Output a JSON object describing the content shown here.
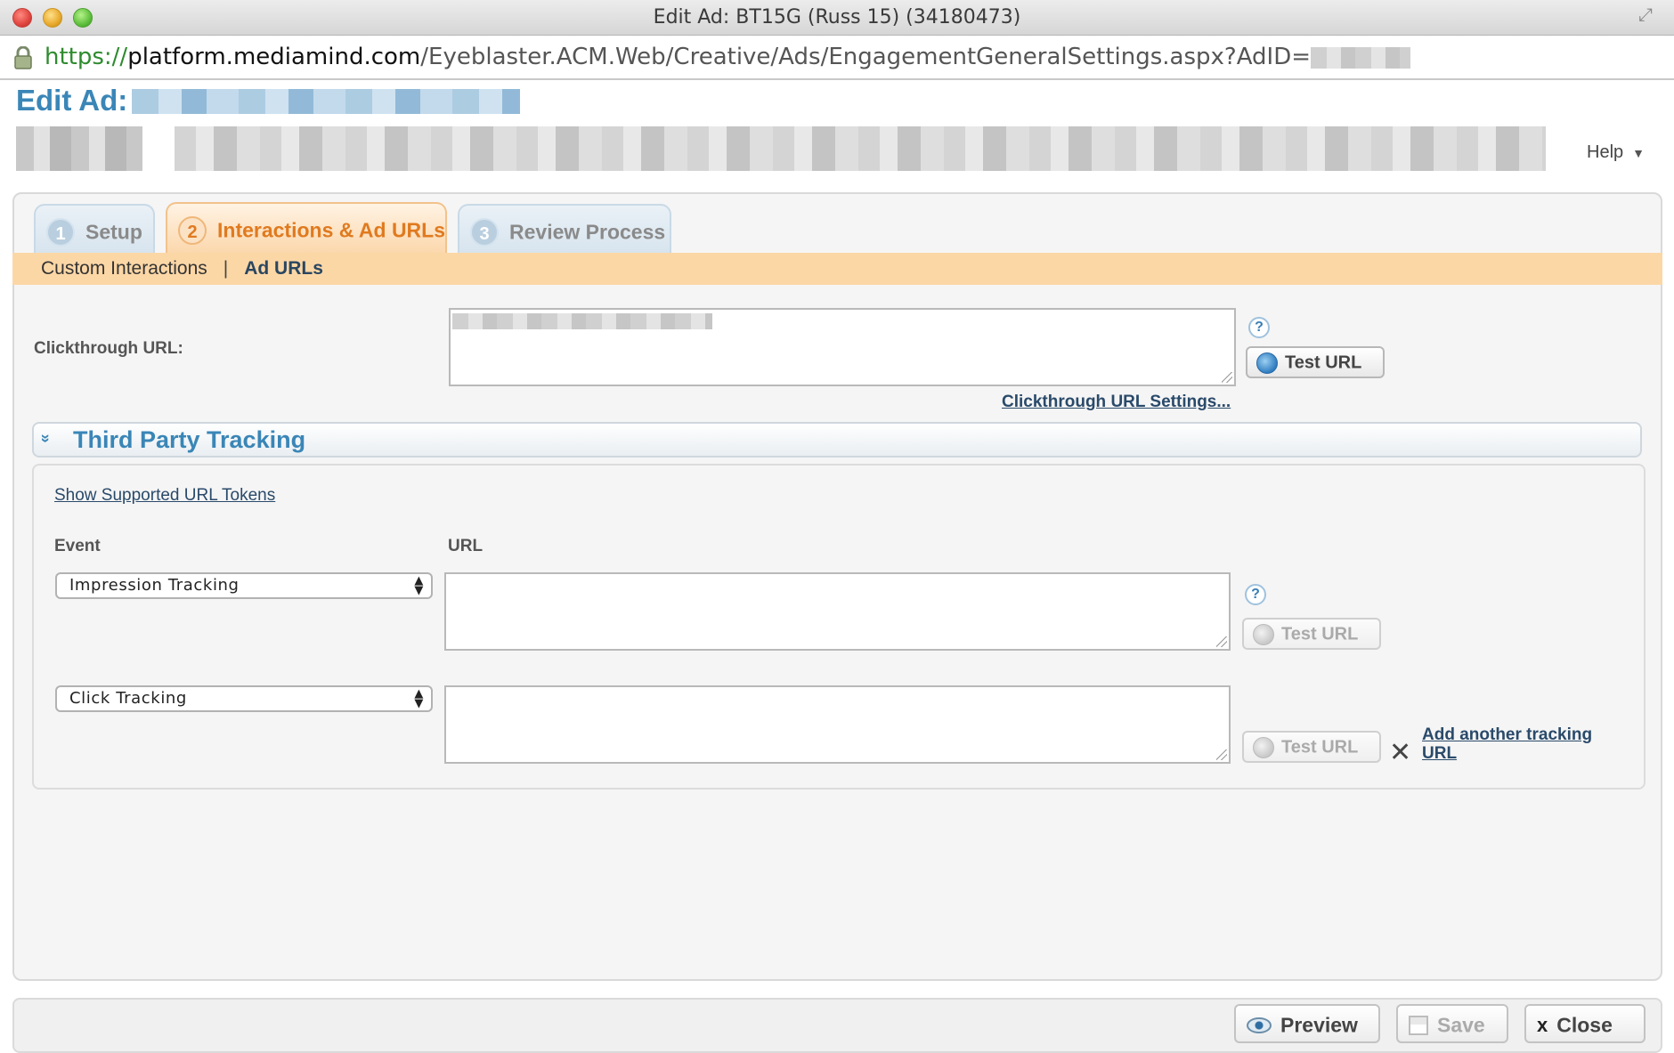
{
  "window": {
    "title": "Edit Ad: BT15G (Russ 15) (34180473)",
    "url_https": "https://",
    "url_domain": "platform.mediamind.com",
    "url_path": "/Eyeblaster.ACM.Web/Creative/Ads/EngagementGeneralSettings.aspx?AdID="
  },
  "header": {
    "title": "Edit Ad:",
    "help_label": "Help"
  },
  "tabs": [
    {
      "number": "1",
      "label": "Setup"
    },
    {
      "number": "2",
      "label": "Interactions & Ad URLs"
    },
    {
      "number": "3",
      "label": "Review Process"
    }
  ],
  "subnav": {
    "items": [
      "Custom Interactions",
      "Ad URLs"
    ],
    "separator": "|"
  },
  "clickthrough": {
    "label": "Clickthrough URL:",
    "help": "?",
    "test_button": "Test URL",
    "settings_link": "Clickthrough URL Settings..."
  },
  "third_party": {
    "section_title": "Third Party Tracking",
    "collapse_glyph": "»",
    "tokens_link": "Show Supported URL Tokens",
    "col_event": "Event",
    "col_url": "URL",
    "rows": [
      {
        "event": "Impression Tracking",
        "url": "",
        "help": "?",
        "test_button": "Test URL"
      },
      {
        "event": "Click Tracking",
        "url": "",
        "test_button": "Test URL",
        "remove": "✕",
        "add_link": "Add another tracking URL"
      }
    ]
  },
  "footer": {
    "preview": "Preview",
    "save": "Save",
    "close": "Close",
    "close_glyph": "x"
  }
}
